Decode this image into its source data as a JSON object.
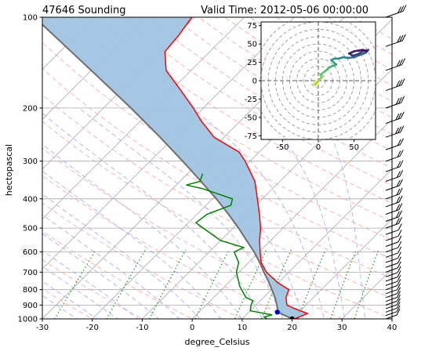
{
  "header": {
    "station": "47646 Sounding",
    "valid_time": "Valid Time: 2012-05-06 00:00:00"
  },
  "chart_data": [
    {
      "type": "skew-t",
      "title_left": "47646 Sounding",
      "title_right": "Valid Time: 2012-05-06 00:00:00",
      "xlabel": "degree_Celsius",
      "ylabel": "hectopascal",
      "xlim": [
        -30,
        40
      ],
      "ylim": [
        1000,
        100
      ],
      "y_scale": "log",
      "x_ticks": [
        -30,
        -20,
        -10,
        0,
        10,
        20,
        30,
        40
      ],
      "y_ticks": [
        1000,
        900,
        800,
        700,
        600,
        500,
        400,
        300,
        200,
        100
      ],
      "grid": true,
      "colors": {
        "temperature": "#ff0000",
        "dewpoint": "#008000",
        "parcel": "#6e6e6e",
        "cape_fill": "#e8a0a8",
        "cin_fill": "#a0c4e2",
        "dry_adiabats": "#f4a6a6",
        "moist_adiabats": "#9aa8f0",
        "mixing_ratio": "#2a9a2a"
      },
      "series": [
        {
          "name": "temperature",
          "points": [
            [
              1000,
              20.5
            ],
            [
              960,
              22.0
            ],
            [
              925,
              18.5
            ],
            [
              900,
              16.2
            ],
            [
              850,
              14.5
            ],
            [
              800,
              13.5
            ],
            [
              760,
              10.0
            ],
            [
              700,
              5.5
            ],
            [
              650,
              2.5
            ],
            [
              600,
              0.2
            ],
            [
              550,
              -2.2
            ],
            [
              500,
              -4.5
            ],
            [
              450,
              -7.5
            ],
            [
              400,
              -11.0
            ],
            [
              350,
              -15.0
            ],
            [
              300,
              -21.0
            ],
            [
              280,
              -24.0
            ],
            [
              250,
              -32.0
            ],
            [
              220,
              -38.0
            ],
            [
              200,
              -42.0
            ],
            [
              175,
              -48.0
            ],
            [
              150,
              -55.0
            ],
            [
              130,
              -59.0
            ],
            [
              115,
              -59.5
            ],
            [
              100,
              -60.5
            ]
          ]
        },
        {
          "name": "dewpoint",
          "points": [
            [
              1000,
              15.0
            ],
            [
              985,
              14.0
            ],
            [
              970,
              15.2
            ],
            [
              940,
              10.0
            ],
            [
              900,
              9.0
            ],
            [
              870,
              8.5
            ],
            [
              850,
              6.5
            ],
            [
              780,
              3.0
            ],
            [
              700,
              -0.5
            ],
            [
              650,
              -2.0
            ],
            [
              600,
              -5.0
            ],
            [
              580,
              -4.0
            ],
            [
              550,
              -10.0
            ],
            [
              500,
              -16.0
            ],
            [
              480,
              -18.5
            ],
            [
              450,
              -18.0
            ],
            [
              420,
              -15.0
            ],
            [
              400,
              -16.0
            ],
            [
              370,
              -24.0
            ],
            [
              360,
              -28.0
            ],
            [
              350,
              -26.0
            ],
            [
              330,
              -27.0
            ]
          ]
        },
        {
          "name": "parcel",
          "points": [
            [
              1000,
              20.0
            ],
            [
              950,
              15.8
            ],
            [
              900,
              14.2
            ],
            [
              850,
              12.3
            ],
            [
              800,
              10.1
            ],
            [
              750,
              7.7
            ],
            [
              700,
              5.0
            ],
            [
              650,
              2.2
            ],
            [
              600,
              -1.0
            ],
            [
              550,
              -4.8
            ],
            [
              500,
              -8.9
            ],
            [
              450,
              -13.7
            ],
            [
              400,
              -19.2
            ],
            [
              350,
              -25.8
            ],
            [
              300,
              -33.5
            ],
            [
              250,
              -42.8
            ],
            [
              200,
              -54.5
            ],
            [
              150,
              -70.0
            ],
            [
              100,
              -92.0
            ]
          ]
        }
      ],
      "markers": [
        {
          "name": "surface",
          "pressure": 1000,
          "temperature": 20.0
        },
        {
          "name": "lcl",
          "pressure": 950,
          "temperature": 15.7
        }
      ],
      "wind_barbs": "right-side profile, 1000 to 100 hPa"
    },
    {
      "type": "hodograph",
      "xlim": [
        -80,
        80
      ],
      "ylim": [
        -80,
        80
      ],
      "x_ticks": [
        -50,
        0,
        50
      ],
      "y_ticks": [
        -75,
        -50,
        -25,
        0,
        25,
        50,
        75
      ],
      "rings": [
        10,
        20,
        30,
        40,
        50,
        60,
        70,
        80,
        90
      ],
      "u": [
        0,
        -3,
        -6,
        -4,
        -2,
        2,
        5,
        3,
        8,
        12,
        15,
        20,
        25,
        18,
        22,
        28,
        35,
        42,
        50,
        58,
        66,
        70,
        62,
        55,
        48,
        43,
        50,
        62,
        68
      ],
      "v": [
        0,
        -2,
        -4,
        -6,
        -3,
        2,
        5,
        8,
        12,
        15,
        18,
        20,
        22,
        28,
        30,
        30,
        32,
        31,
        32,
        35,
        38,
        42,
        40,
        36,
        34,
        37,
        40,
        42,
        40
      ]
    }
  ]
}
